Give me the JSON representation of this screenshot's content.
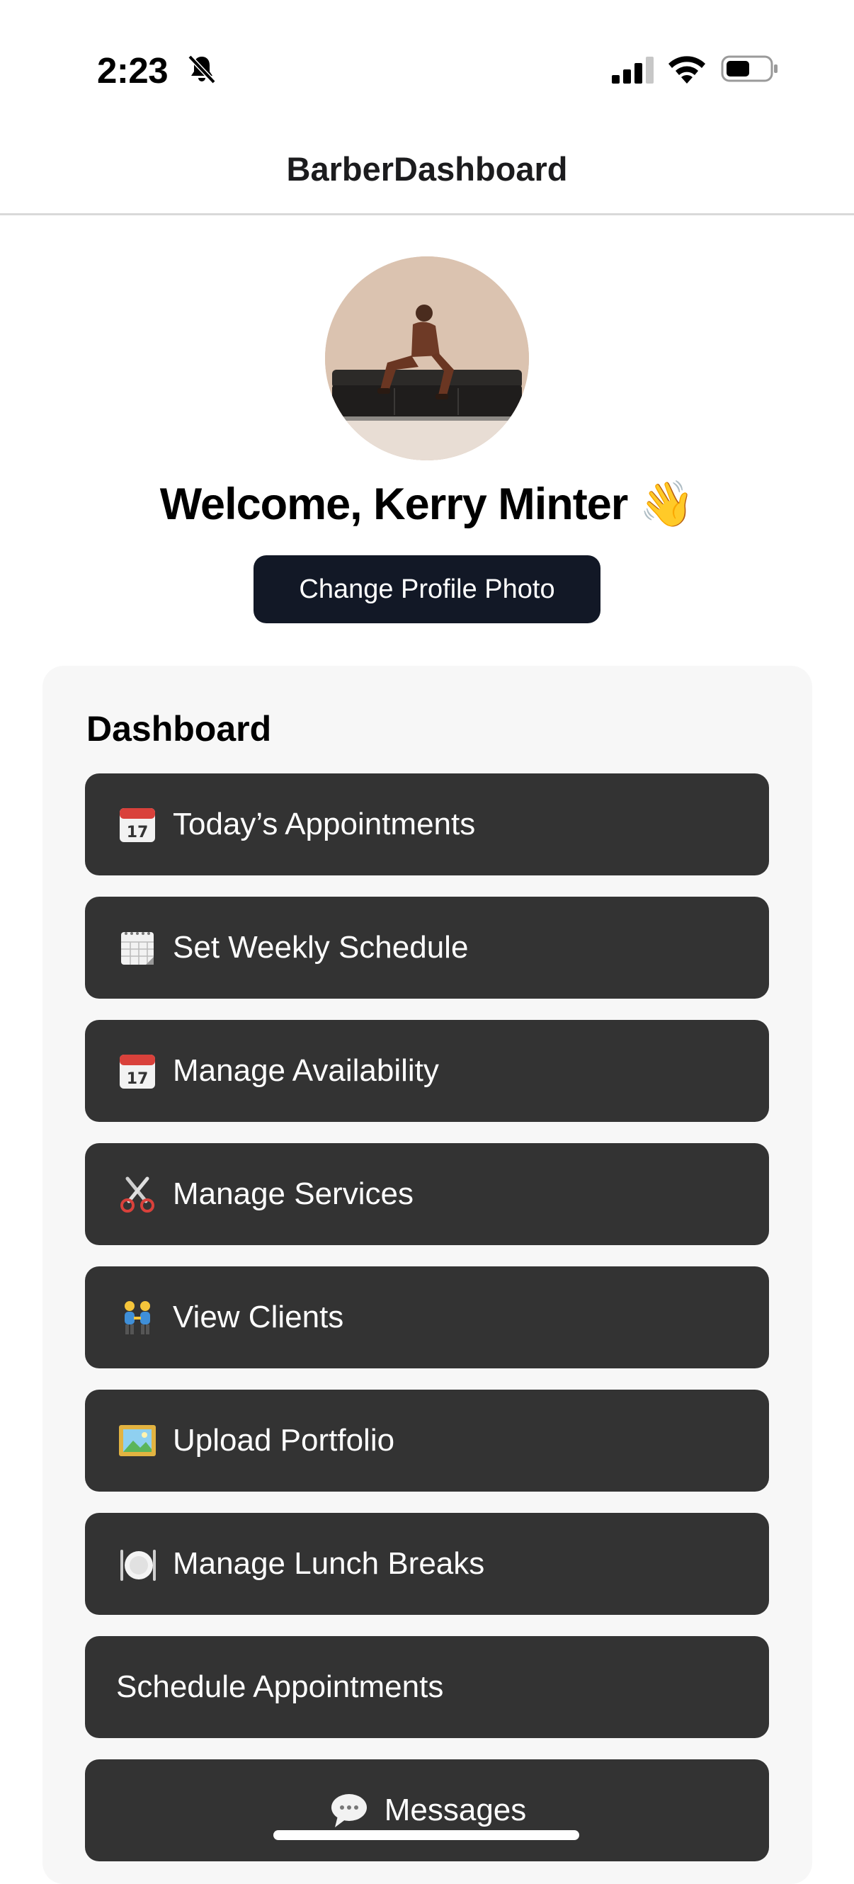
{
  "status_bar": {
    "time": "2:23",
    "icons": [
      "bell-slash-icon",
      "cellular-signal-icon",
      "wifi-icon",
      "battery-icon"
    ]
  },
  "header": {
    "title": "BarberDashboard"
  },
  "profile": {
    "welcome": "Welcome, Kerry Minter 👋",
    "change_photo_label": "Change Profile Photo"
  },
  "dashboard": {
    "heading": "Dashboard",
    "items": [
      {
        "icon": "calendar-icon",
        "label": "Today’s Appointments"
      },
      {
        "icon": "spiral-calendar-icon",
        "label": "Set Weekly Schedule"
      },
      {
        "icon": "calendar-icon",
        "label": "Manage Availability"
      },
      {
        "icon": "scissors-icon",
        "label": "Manage Services"
      },
      {
        "icon": "people-holding-hands-icon",
        "label": "View Clients"
      },
      {
        "icon": "framed-picture-icon",
        "label": "Upload Portfolio"
      },
      {
        "icon": "plate-cutlery-icon",
        "label": "Manage Lunch Breaks"
      },
      {
        "icon": "",
        "label": "Schedule Appointments"
      },
      {
        "icon": "speech-bubble-icon",
        "label": "Messages"
      }
    ]
  },
  "colors": {
    "button_dark": "#333333",
    "primary_button": "#121826",
    "card_background": "#f7f7f7"
  }
}
